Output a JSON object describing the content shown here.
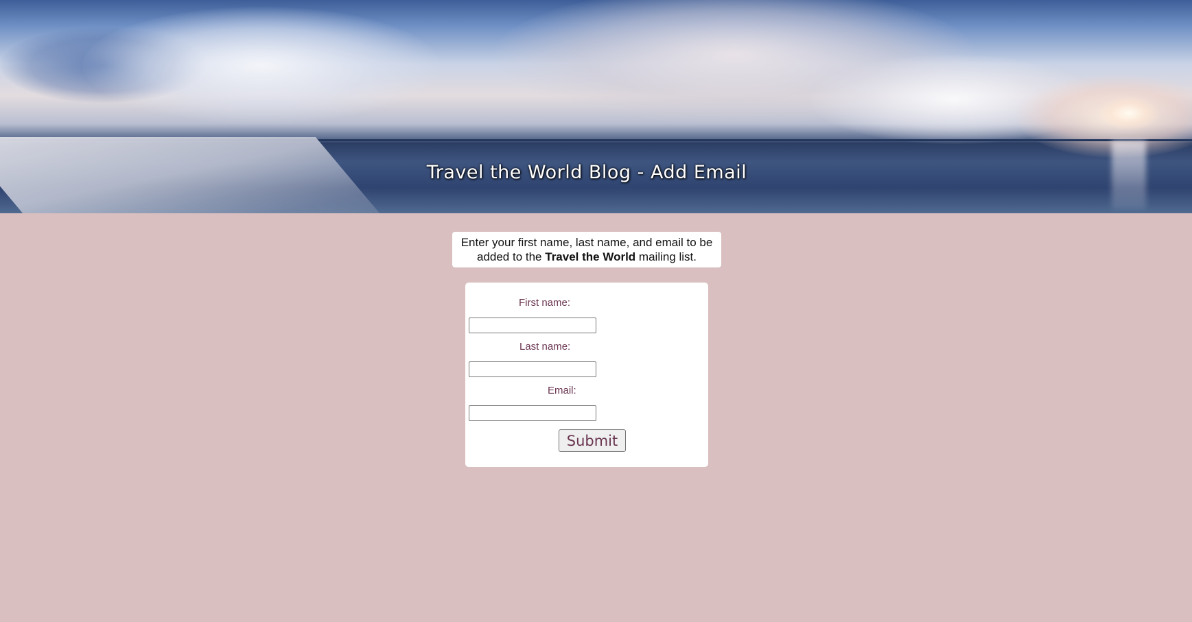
{
  "header": {
    "title": "Travel the World Blog - Add Email"
  },
  "intro": {
    "text_before": "Enter your first name, last name, and email to be added to the ",
    "bold": "Travel the World",
    "text_after": " mailing list."
  },
  "form": {
    "first_name_label": "First name:",
    "first_name_value": "",
    "last_name_label": "Last name:",
    "last_name_value": "",
    "email_label": "Email:",
    "email_value": "",
    "submit_label": "Submit"
  },
  "colors": {
    "page_background": "#d9bfbf",
    "label_text": "#6a3550",
    "card_background": "#ffffff"
  }
}
